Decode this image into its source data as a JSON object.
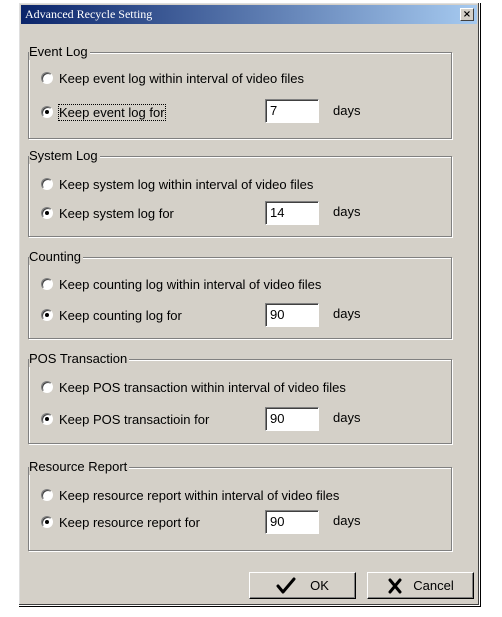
{
  "window": {
    "title": "Advanced Recycle Setting",
    "close_icon": "×"
  },
  "groups": [
    {
      "title": "Event Log",
      "option_interval": "Keep event log within interval of video files",
      "option_keep": "Keep event log for",
      "value": "7",
      "unit": "days"
    },
    {
      "title": "System Log",
      "option_interval": "Keep system log within interval of video files",
      "option_keep": "Keep system log for",
      "value": "14",
      "unit": "days"
    },
    {
      "title": "Counting",
      "option_interval": "Keep counting log within interval of video files",
      "option_keep": "Keep counting log for",
      "value": "90",
      "unit": "days"
    },
    {
      "title": "POS Transaction",
      "option_interval": "Keep POS transaction within interval of video files",
      "option_keep": "Keep POS transactioin for",
      "value": "90",
      "unit": "days"
    },
    {
      "title": "Resource Report",
      "option_interval": "Keep resource report within interval of video files",
      "option_keep": "Keep resource report for",
      "value": "90",
      "unit": "days"
    }
  ],
  "buttons": {
    "ok_label": "OK",
    "cancel_label": "Cancel"
  }
}
